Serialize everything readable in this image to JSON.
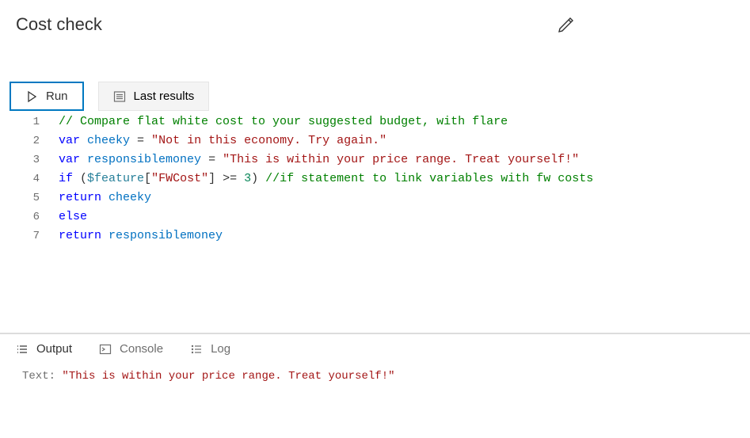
{
  "header": {
    "title": "Cost check"
  },
  "toolbar": {
    "run_label": "Run",
    "last_results_label": "Last results"
  },
  "code": {
    "lines": {
      "l1_comment": "// Compare flat white cost to your suggested budget, with flare",
      "l2_var": "var",
      "l2_name": "cheeky",
      "l2_eq": " = ",
      "l2_str": "\"Not in this economy. Try again.\"",
      "l3_var": "var",
      "l3_name": "responsiblemoney",
      "l3_eq": " = ",
      "l3_str": "\"This is within your price range. Treat yourself!\"",
      "l4_if": "if",
      "l4_p1": " (",
      "l4_builtin": "$feature",
      "l4_b1": "[",
      "l4_key": "\"FWCost\"",
      "l4_b2": "]",
      "l4_op": " >= ",
      "l4_num": "3",
      "l4_p2": ") ",
      "l4_comment": "//if statement to link variables with fw costs",
      "l5_ret": "return",
      "l5_sp": " ",
      "l5_name": "cheeky",
      "l6_else": "else",
      "l7_ret": "return",
      "l7_sp": " ",
      "l7_name": "responsiblemoney"
    },
    "line_numbers": [
      "1",
      "2",
      "3",
      "4",
      "5",
      "6",
      "7"
    ]
  },
  "output_tabs": {
    "output": "Output",
    "console": "Console",
    "log": "Log"
  },
  "output": {
    "label": "Text: ",
    "value": "\"This is within your price range. Treat yourself!\""
  }
}
